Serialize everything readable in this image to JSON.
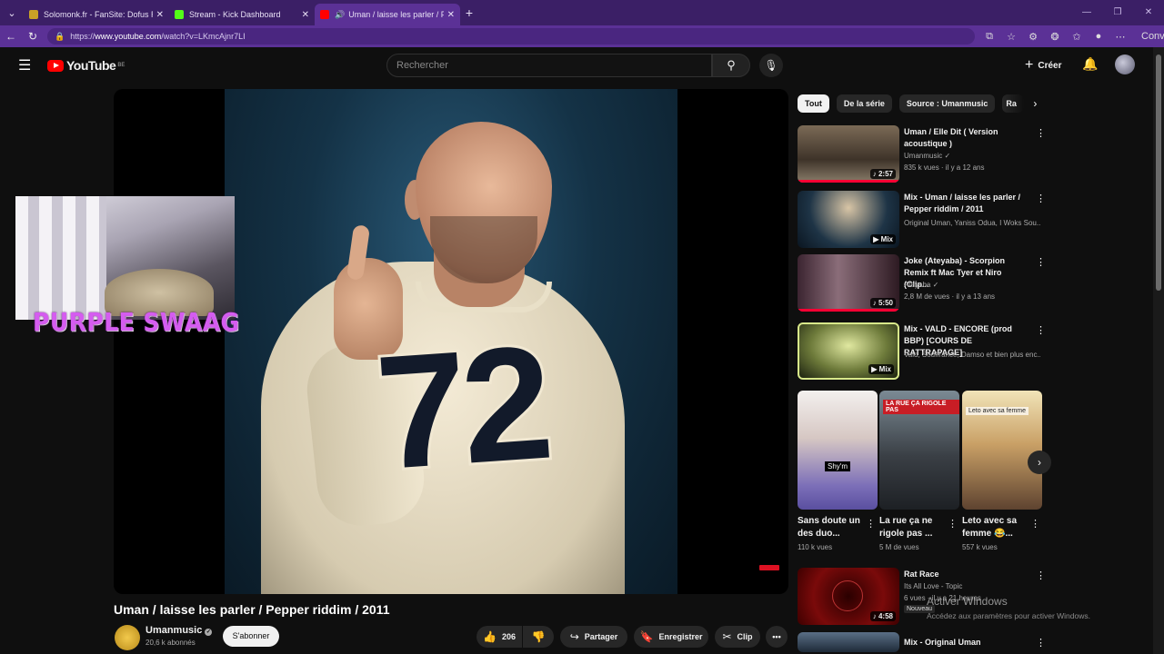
{
  "browser": {
    "tabs": [
      {
        "title": "Solomonk.fr - FanSite: Dofus Rétro",
        "fav_color": "#c9a227"
      },
      {
        "title": "Stream - Kick Dashboard",
        "fav_color": "#53fc18"
      },
      {
        "title": "Uman / laisse les parler / Pepp",
        "fav_color": "#ff0000"
      }
    ],
    "url_prefix": "https://",
    "url_host": "www.youtube.com",
    "url_path": "/watch?v=LKmcAjnr7LI",
    "conversation_label": "Conversation"
  },
  "header": {
    "logo": "YouTube",
    "region": "BE",
    "search_placeholder": "Rechercher",
    "create_label": "Créer"
  },
  "overlay": {
    "text": "PURPLE SWAAG"
  },
  "video": {
    "title": "Uman / laisse les parler / Pepper riddim / 2011",
    "jersey_number": "72",
    "channel": "Umanmusic",
    "subscribers": "20,6 k abonnés",
    "subscribe_label": "S'abonner",
    "likes": "206",
    "share_label": "Partager",
    "save_label": "Enregistrer",
    "clip_label": "Clip",
    "more_label": "•••"
  },
  "chips": [
    "Tout",
    "De la série",
    "Source : Umanmusic",
    "Ra"
  ],
  "recommendations": [
    {
      "title": "Uman / Elle Dit ( Version acoustique )",
      "channel": "Umanmusic",
      "meta": "835 k vues · il y a 12 ans",
      "duration": "2:57",
      "verified": true
    },
    {
      "title": "Mix - Uman / laisse les parler / Pepper riddim / 2011",
      "channel": "Original Uman, Yaniss Odua, I Woks Sou...",
      "meta": "",
      "duration": "Mix",
      "verified": false
    },
    {
      "title": "Joke (Ateyaba) - Scorpion Remix ft Mac Tyer et Niro (Clip...",
      "channel": "Ateyaba",
      "meta": "2,8 M de vues · il y a 13 ans",
      "duration": "5:50",
      "verified": true
    },
    {
      "title": "Mix - VALD - ENCORE (prod BBP) [COURS DE RATTRAPAGE]",
      "channel": "Vald, Souffrance, Damso et bien plus enc...",
      "meta": "",
      "duration": "Mix",
      "verified": false
    }
  ],
  "shorts": [
    {
      "title": "Sans doute un des duo...",
      "views": "110 k vues",
      "overlay": "Shy'm"
    },
    {
      "title": "La rue ça ne rigole pas ...",
      "views": "5 M de vues",
      "overlay": "LA RUE ÇA RIGOLE PAS"
    },
    {
      "title": "Leto avec sa femme 😂...",
      "views": "557 k vues",
      "overlay": "Leto avec sa femme"
    }
  ],
  "more_recs": [
    {
      "title": "Rat Race",
      "channel": "Its All Love - Topic",
      "meta": "6 vues · il y a 21 heures",
      "duration": "4:58",
      "badge": "Nouveau"
    },
    {
      "title": "Mix - Original Uman"
    }
  ],
  "activation": {
    "title": "Activer Windows",
    "subtitle": "Accédez aux paramètres pour activer Windows."
  }
}
